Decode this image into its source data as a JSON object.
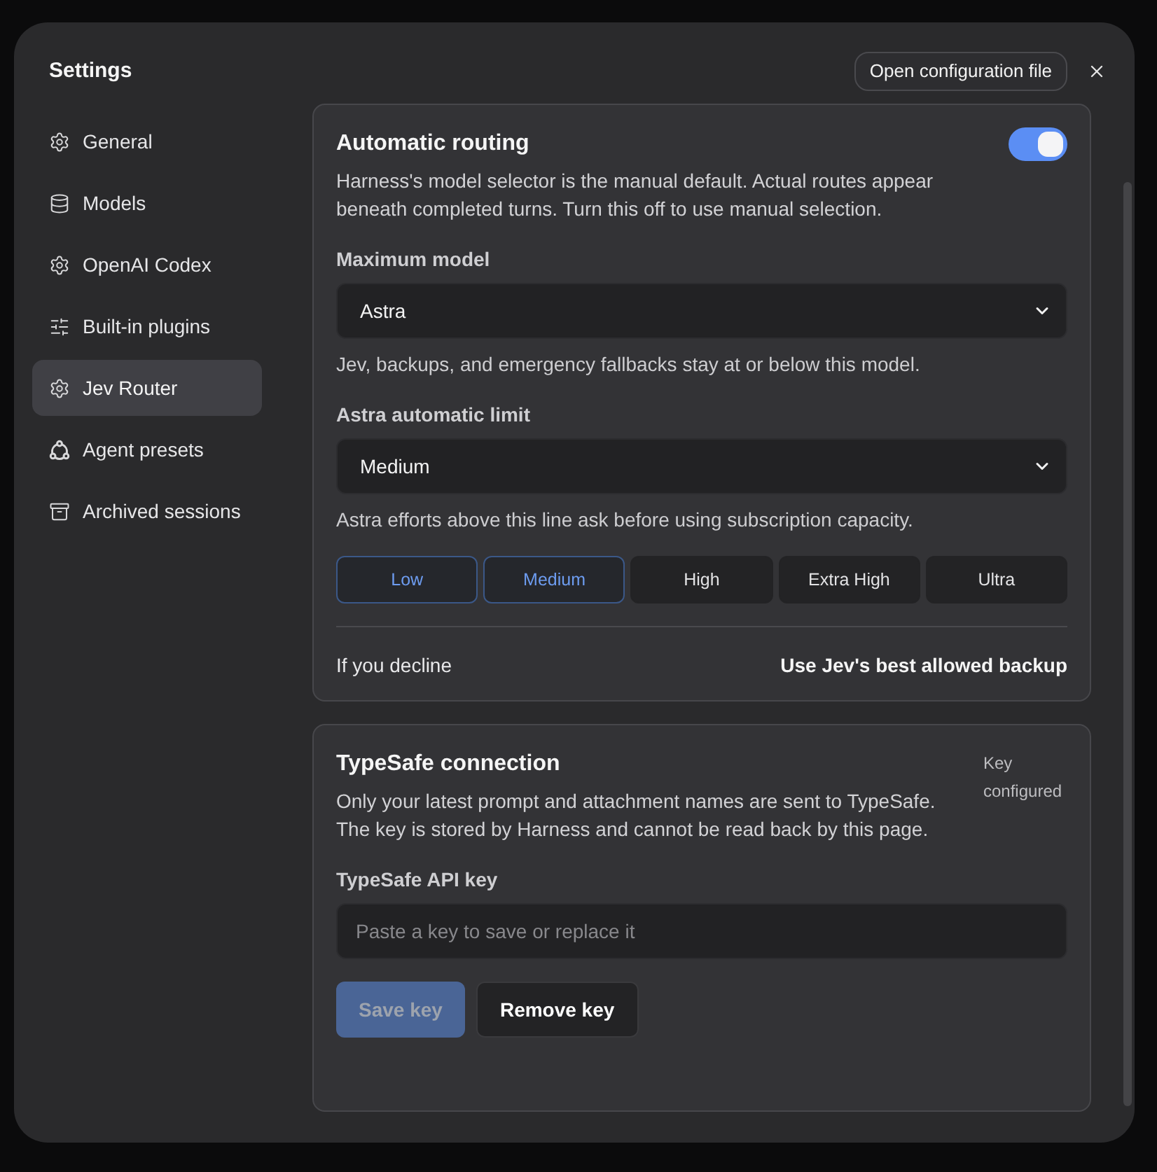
{
  "dialog": {
    "title": "Settings",
    "config_button": "Open configuration file"
  },
  "sidebar": {
    "items": [
      {
        "label": "General",
        "selected": false
      },
      {
        "label": "Models",
        "selected": false
      },
      {
        "label": "OpenAI Codex",
        "selected": false
      },
      {
        "label": "Built-in plugins",
        "selected": false
      },
      {
        "label": "Jev Router",
        "selected": true
      },
      {
        "label": "Agent presets",
        "selected": false
      },
      {
        "label": "Archived sessions",
        "selected": false
      }
    ]
  },
  "routing": {
    "title": "Automatic routing",
    "on": true,
    "description": "Harness's model selector is the manual default. Actual routes appear beneath completed turns. Turn this off to use manual selection.",
    "max_model": {
      "label": "Maximum model",
      "value": "Astra",
      "hint": "Jev, backups, and emergency fallbacks stay at or below this model."
    },
    "limit": {
      "label": "Astra automatic limit",
      "value": "Medium",
      "hint": "Astra efforts above this line ask before using subscription capacity."
    },
    "efforts": [
      {
        "label": "Low",
        "selected": true
      },
      {
        "label": "Medium",
        "selected": true
      },
      {
        "label": "High",
        "selected": false
      },
      {
        "label": "Extra High",
        "selected": false
      },
      {
        "label": "Ultra",
        "selected": false
      }
    ],
    "decline": {
      "label": "If you decline",
      "value": "Use Jev's best allowed backup"
    }
  },
  "typesafe": {
    "title": "TypeSafe connection",
    "status": "Key configured",
    "description": "Only your latest prompt and attachment names are sent to TypeSafe. The key is stored by Harness and cannot be read back by this page.",
    "key_field": {
      "label": "TypeSafe API key",
      "placeholder": "Paste a key to save or replace it"
    },
    "buttons": [
      {
        "kind": "save",
        "label": "Save key",
        "disabled": true
      },
      {
        "kind": "remove",
        "label": "Remove key",
        "disabled": false
      }
    ]
  }
}
